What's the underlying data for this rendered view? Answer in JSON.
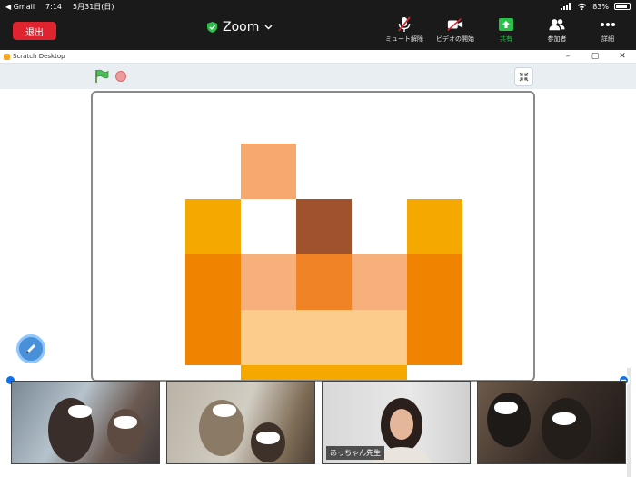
{
  "status_bar": {
    "back_app": "◀ Gmail",
    "time": "7:14",
    "date": "5月31日(日)",
    "battery": "83%",
    "battery_level": 0.83
  },
  "zoom_toolbar": {
    "leave_label": "退出",
    "title": "Zoom",
    "tools": [
      {
        "label": "ミュート解除",
        "icon": "mic-muted-icon"
      },
      {
        "label": "ビデオの開始",
        "icon": "video-off-icon"
      },
      {
        "label": "共有",
        "icon": "share-screen-icon"
      },
      {
        "label": "参加者",
        "icon": "participants-icon"
      },
      {
        "label": "詳細",
        "icon": "more-dots-icon"
      }
    ]
  },
  "scratch_window": {
    "title": "Scratch Desktop",
    "controls": [
      "–",
      "▢",
      "✕"
    ]
  },
  "participants": [
    {
      "name": ""
    },
    {
      "name": ""
    },
    {
      "name": "あっちゃん先生"
    },
    {
      "name": ""
    }
  ],
  "colors": {
    "leave_red": "#e0242f",
    "share_green": "#2bc04a",
    "zoom_blue": "#0e72ed",
    "pixel_gold": "#f5a800",
    "pixel_orange": "#f08300",
    "pixel_peach": "#f7b07c",
    "pixel_brown": "#a0522d",
    "pixel_light": "#fccd8a"
  }
}
